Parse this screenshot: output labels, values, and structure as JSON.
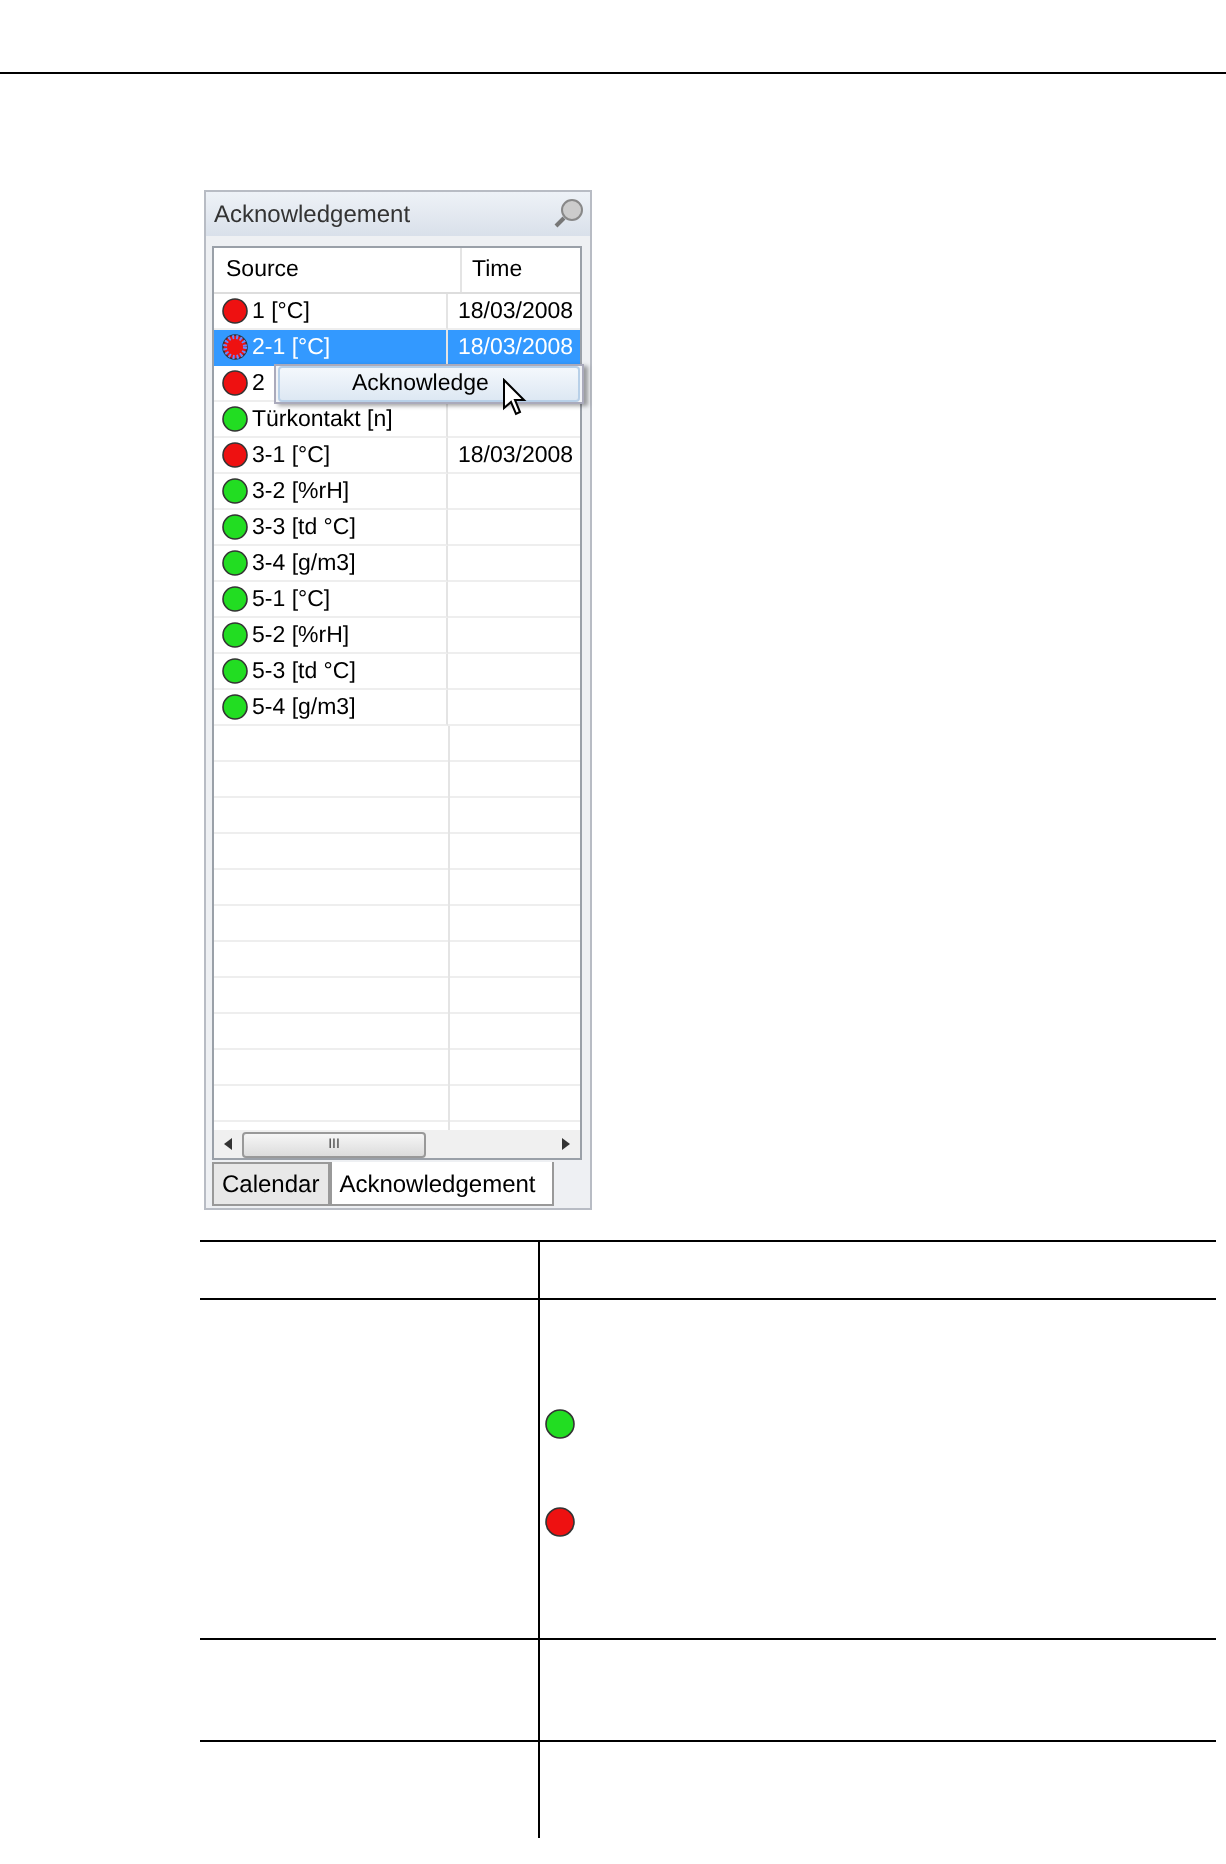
{
  "panel": {
    "title": "Acknowledgement",
    "columns": [
      "Source",
      "Time"
    ],
    "rows": [
      {
        "source": "1 [°C]",
        "time": "18/03/2008",
        "color": "#ee1111",
        "selected": false
      },
      {
        "source": "2-1 [°C]",
        "time": "18/03/2008",
        "color": "#ee1111",
        "selected": true
      },
      {
        "source": "2",
        "color": "#ee1111",
        "selected": false
      },
      {
        "source": "Türkontakt [n]",
        "color": "#22dd22",
        "selected": false
      },
      {
        "source": "3-1 [°C]",
        "time": "18/03/2008",
        "color": "#ee1111",
        "selected": false
      },
      {
        "source": "3-2 [%rH]",
        "color": "#22dd22",
        "selected": false
      },
      {
        "source": "3-3 [td °C]",
        "color": "#22dd22",
        "selected": false
      },
      {
        "source": "3-4 [g/m3]",
        "color": "#22dd22",
        "selected": false
      },
      {
        "source": "5-1 [°C]",
        "color": "#22dd22",
        "selected": false
      },
      {
        "source": "5-2 [%rH]",
        "color": "#22dd22",
        "selected": false
      },
      {
        "source": "5-3 [td °C]",
        "color": "#22dd22",
        "selected": false
      },
      {
        "source": "5-4 [g/m3]",
        "color": "#22dd22",
        "selected": false
      }
    ],
    "context_menu": {
      "item": "Acknowledge"
    },
    "scrollbar_grip": "III",
    "tabs": [
      {
        "label": "Calendar",
        "selected": false
      },
      {
        "label": "Acknowledgement",
        "selected": true
      }
    ]
  },
  "legend": [
    {
      "color": "#22dd22"
    },
    {
      "color": "#ee1111"
    }
  ]
}
